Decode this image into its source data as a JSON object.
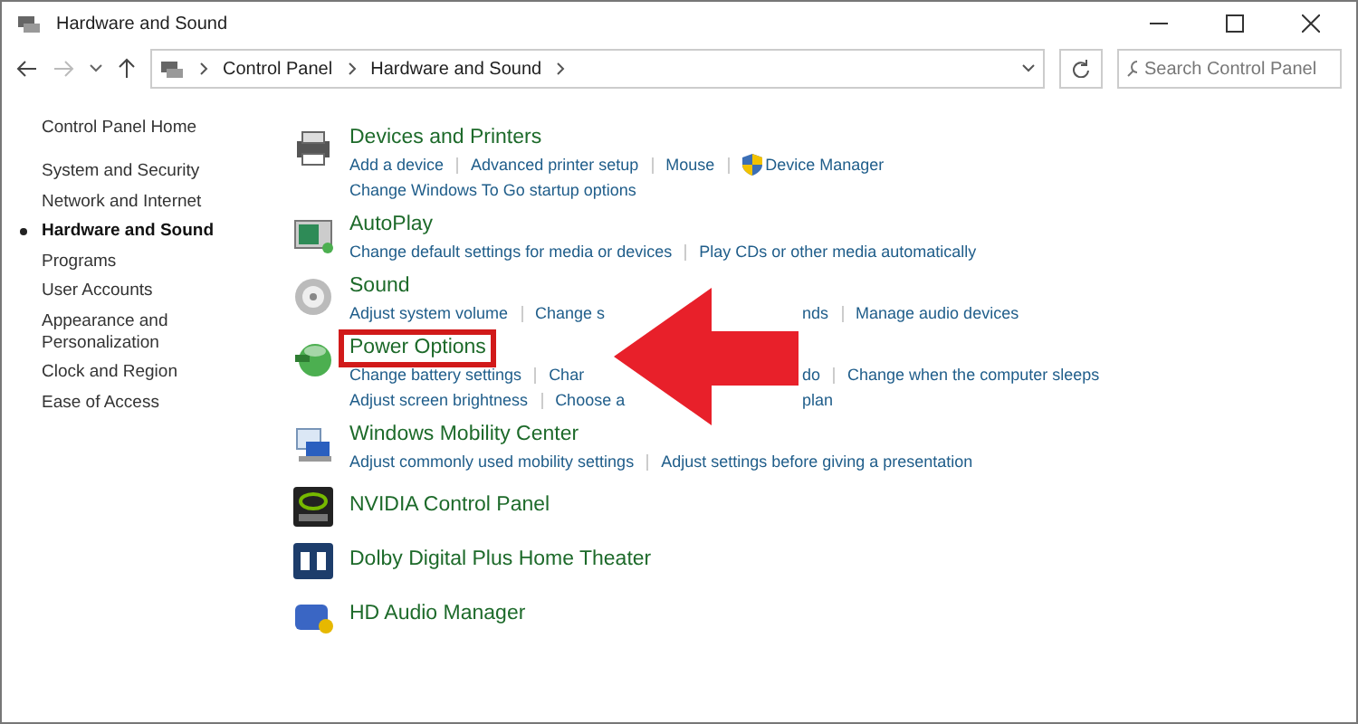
{
  "window": {
    "title": "Hardware and Sound"
  },
  "address_bar": {
    "breadcrumbs": [
      "Control Panel",
      "Hardware and Sound"
    ]
  },
  "search": {
    "placeholder": "Search Control Panel"
  },
  "sidebar": {
    "items": [
      {
        "label": "Control Panel Home",
        "selected": false
      },
      {
        "label": "System and Security",
        "selected": false
      },
      {
        "label": "Network and Internet",
        "selected": false
      },
      {
        "label": "Hardware and Sound",
        "selected": true
      },
      {
        "label": "Programs",
        "selected": false
      },
      {
        "label": "User Accounts",
        "selected": false
      },
      {
        "label": "Appearance and Personalization",
        "selected": false
      },
      {
        "label": "Clock and Region",
        "selected": false
      },
      {
        "label": "Ease of Access",
        "selected": false
      }
    ]
  },
  "categories": [
    {
      "title": "Devices and Printers",
      "kind": "printer",
      "highlighted": false,
      "link_rows": [
        [
          {
            "kind": "link",
            "text": "Add a device"
          },
          {
            "kind": "link",
            "text": "Advanced printer setup"
          },
          {
            "kind": "link",
            "text": "Mouse"
          },
          {
            "kind": "shield",
            "text": "Device Manager"
          }
        ],
        [
          {
            "kind": "link",
            "text": "Change Windows To Go startup options"
          }
        ]
      ]
    },
    {
      "title": "AutoPlay",
      "kind": "autoplay",
      "highlighted": false,
      "link_rows": [
        [
          {
            "kind": "link",
            "text": "Change default settings for media or devices"
          },
          {
            "kind": "link",
            "text": "Play CDs or other media automatically"
          }
        ]
      ]
    },
    {
      "title": "Sound",
      "kind": "speaker",
      "highlighted": false,
      "link_rows": [
        [
          {
            "kind": "link",
            "text": "Adjust system volume"
          },
          {
            "kind": "cut",
            "text": "Change s"
          },
          {
            "kind": "tail",
            "text": "nds"
          },
          {
            "kind": "link",
            "text": "Manage audio devices"
          }
        ]
      ]
    },
    {
      "title": "Power Options",
      "kind": "power",
      "highlighted": true,
      "link_rows": [
        [
          {
            "kind": "link",
            "text": "Change battery settings"
          },
          {
            "kind": "cut",
            "text": "Char"
          },
          {
            "kind": "tail",
            "text": "do"
          },
          {
            "kind": "link",
            "text": "Change when the computer sleeps"
          }
        ],
        [
          {
            "kind": "link",
            "text": "Adjust screen brightness"
          },
          {
            "kind": "cut",
            "text": "Choose a"
          },
          {
            "kind": "tail",
            "text": "plan"
          }
        ]
      ]
    },
    {
      "title": "Windows Mobility Center",
      "kind": "laptop",
      "highlighted": false,
      "link_rows": [
        [
          {
            "kind": "link",
            "text": "Adjust commonly used mobility settings"
          },
          {
            "kind": "link",
            "text": "Adjust settings before giving a presentation"
          }
        ]
      ]
    },
    {
      "title": "NVIDIA Control Panel",
      "kind": "nvidia",
      "highlighted": false
    },
    {
      "title": "Dolby Digital Plus Home Theater",
      "kind": "dolby",
      "highlighted": false
    },
    {
      "title": "HD Audio Manager",
      "kind": "hdaudio",
      "highlighted": false
    }
  ]
}
